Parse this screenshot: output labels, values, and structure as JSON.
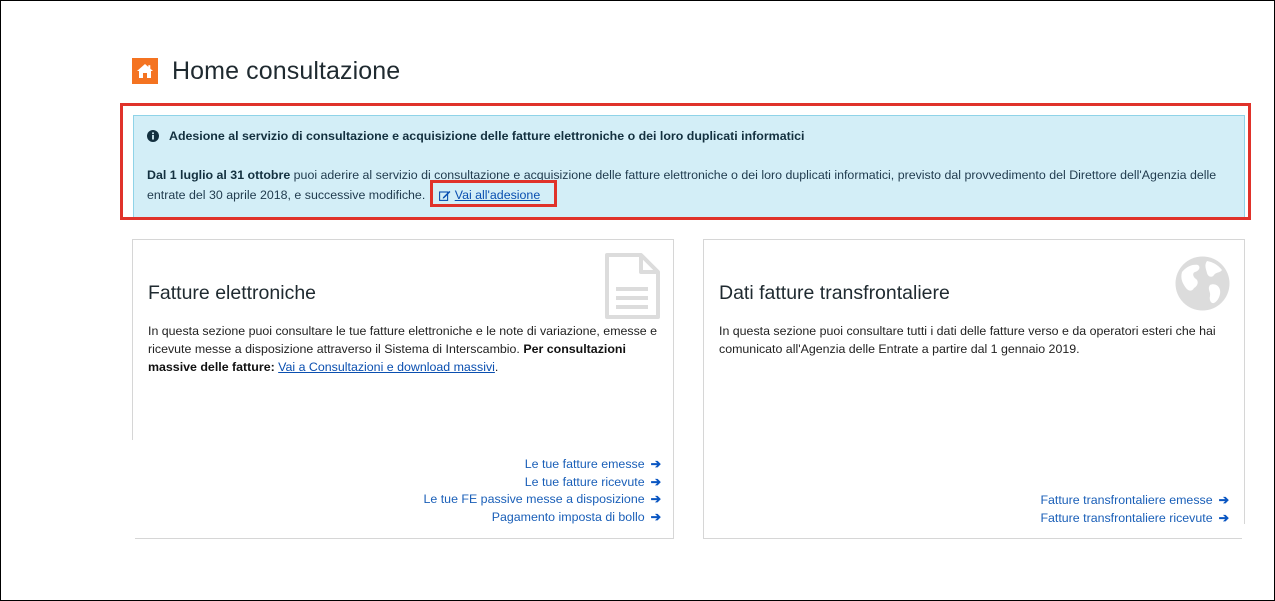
{
  "page": {
    "title": "Home consultazione"
  },
  "notice": {
    "title": "Adesione al servizio di consultazione e acquisizione delle fatture elettroniche o dei loro duplicati informatici",
    "date_range": "Dal 1 luglio al 31 ottobre",
    "body_text": " puoi aderire al servizio di consultazione e acquisizione delle fatture elettroniche o dei loro duplicati informatici, previsto dal provvedimento del Direttore dell'Agenzia delle entrate del 30 aprile 2018, e successive modifiche.",
    "join_link": "Vai all'adesione"
  },
  "cards": {
    "electronic": {
      "title": "Fatture elettroniche",
      "text": "In questa sezione puoi consultare le tue fatture elettroniche e le note di variazione, emesse e ricevute messe a disposizione attraverso il Sistema di Interscambio.",
      "bold_text": " Per consultazioni massive delle fatture:",
      "massive_link": "Vai a Consultazioni e download massivi",
      "links": [
        "Le tue fatture emesse",
        "Le tue fatture ricevute",
        "Le tue FE passive messe a disposizione",
        "Pagamento imposta di bollo"
      ]
    },
    "crossborder": {
      "title": "Dati fatture transfrontaliere",
      "text": "In questa sezione puoi consultare tutti i dati delle fatture verso e da operatori esteri che hai comunicato all'Agenzia delle Entrate a partire dal 1 gennaio 2019.",
      "links": [
        "Fatture transfrontaliere emesse",
        "Fatture transfrontaliere ricevute"
      ]
    }
  },
  "icons": {
    "home": "home-icon",
    "info": "info-icon",
    "edit": "edit-icon",
    "document": "document-icon",
    "globe": "globe-icon",
    "arrow": "arrow-right-icon"
  },
  "colors": {
    "accent_orange": "#f47321",
    "highlight_red": "#e0322a",
    "notice_bg": "#d3eef7",
    "link_blue": "#1a5fb8"
  }
}
